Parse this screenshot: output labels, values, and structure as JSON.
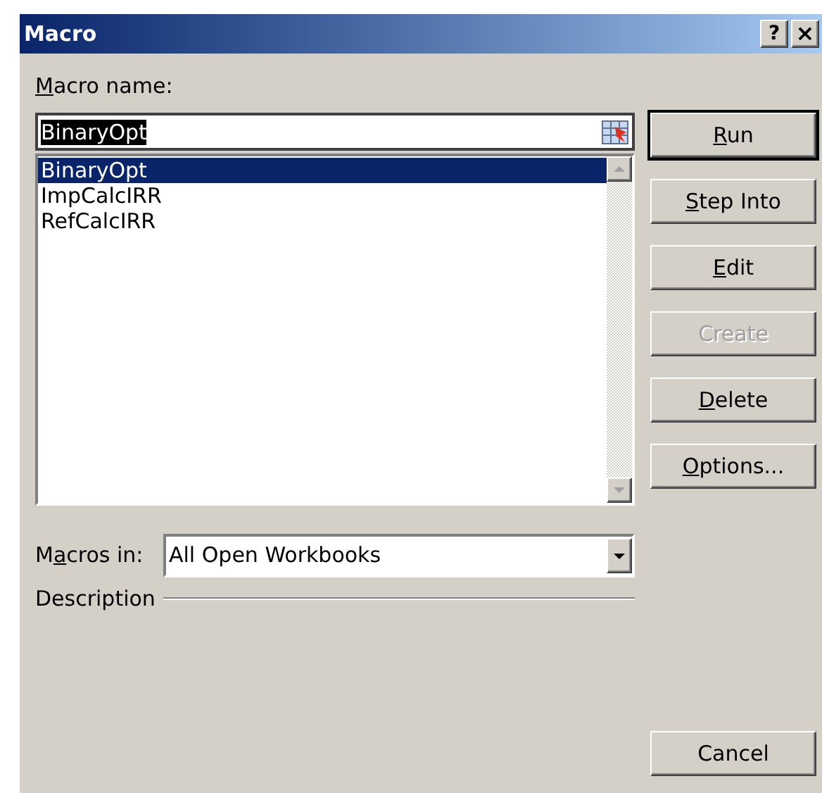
{
  "window": {
    "title": "Macro",
    "help_button": "?",
    "close_button": "×"
  },
  "macro_name": {
    "label": [
      {
        "text": "M",
        "underline": true
      },
      {
        "text": "acro name:",
        "underline": false
      }
    ],
    "value": "BinaryOpt"
  },
  "macros": [
    {
      "name": "BinaryOpt",
      "selected": true
    },
    {
      "name": "ImpCalcIRR",
      "selected": false
    },
    {
      "name": "RefCalcIRR",
      "selected": false
    }
  ],
  "buttons": [
    {
      "label": [
        {
          "text": "R",
          "underline": true
        },
        {
          "text": "un",
          "underline": false
        }
      ],
      "disabled": false,
      "default": true
    },
    {
      "label": [
        {
          "text": "S",
          "underline": true
        },
        {
          "text": "tep Into",
          "underline": false
        }
      ],
      "disabled": false,
      "default": false
    },
    {
      "label": [
        {
          "text": "E",
          "underline": true
        },
        {
          "text": "dit",
          "underline": false
        }
      ],
      "disabled": false,
      "default": false
    },
    {
      "label": [
        {
          "text": "Create",
          "underline": false
        }
      ],
      "disabled": true,
      "default": false
    },
    {
      "label": [
        {
          "text": "D",
          "underline": true
        },
        {
          "text": "elete",
          "underline": false
        }
      ],
      "disabled": false,
      "default": false
    },
    {
      "label": [
        {
          "text": "O",
          "underline": true
        },
        {
          "text": "ptions...",
          "underline": false
        }
      ],
      "disabled": false,
      "default": false
    }
  ],
  "macros_in": {
    "label": [
      {
        "text": "M",
        "underline": false
      },
      {
        "text": "a",
        "underline": true
      },
      {
        "text": "cros in:",
        "underline": false
      }
    ],
    "value": "All Open Workbooks"
  },
  "description": {
    "label": "Description"
  },
  "cancel_button": {
    "label": "Cancel"
  }
}
